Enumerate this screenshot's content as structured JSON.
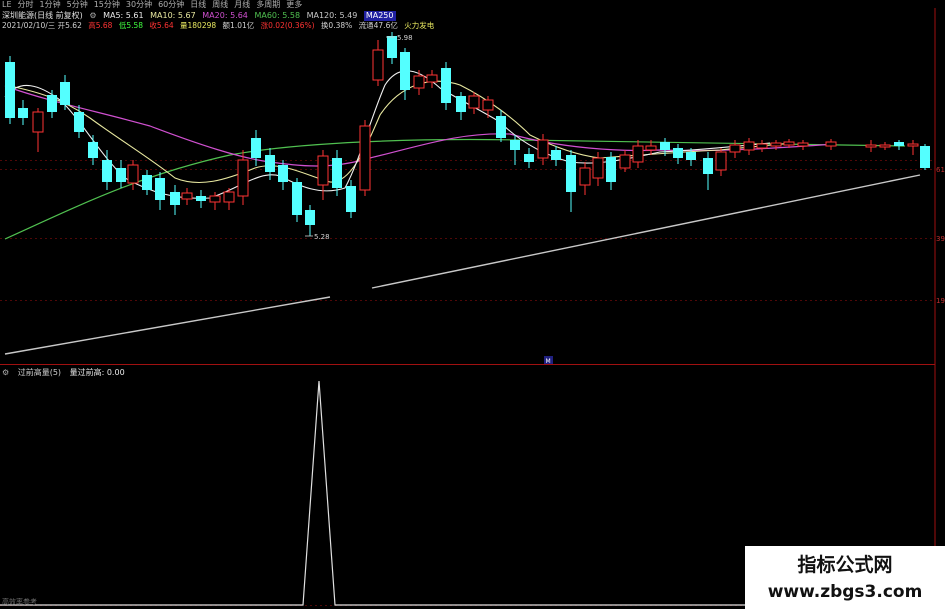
{
  "toolbar": {
    "items": [
      "LE",
      "分时",
      "1分钟",
      "5分钟",
      "15分钟",
      "30分钟",
      "60分钟",
      "日线",
      "周线",
      "月线",
      "多周期",
      "更多"
    ]
  },
  "header": {
    "stock": "深圳能源(日线 前复权)",
    "ma5": "MA5: 5.61",
    "ma10": "MA10: 5.67",
    "ma20": "MA20: 5.64",
    "ma60": "MA60: 5.58",
    "ma120": "MA120: 5.49",
    "ma250": "MA250",
    "date_open": "2021/02/10/三 开5.62",
    "high": "高5.68",
    "low": "低5.58",
    "close": "收5.64",
    "volume": "量180298",
    "amount": "额1.01亿",
    "change": "涨0.02(0.36%)",
    "turnover": "换0.38%",
    "float_cap": "流通47.6亿",
    "sector": "火力发电"
  },
  "colors": {
    "up": "#ff3333",
    "down": "#54ffff",
    "ma5": "#e8e8e8",
    "ma10": "#e8e8a0",
    "ma20": "#d050d0",
    "ma60": "#50c050",
    "ma120": "#c8c8c8",
    "grid": "#a01010"
  },
  "main_chart": {
    "high_label": "5.98",
    "low_label": "5.28",
    "axis_ticks": [
      "61",
      "39",
      "19"
    ],
    "sub_marker": "M"
  },
  "sub_chart": {
    "indicator": "过前高量(5)",
    "value": "量过前高: 0.00"
  },
  "bottom_left": "高效率参考",
  "watermark": {
    "line1": "指标公式网",
    "line2": "www.zbgs3.com"
  }
}
